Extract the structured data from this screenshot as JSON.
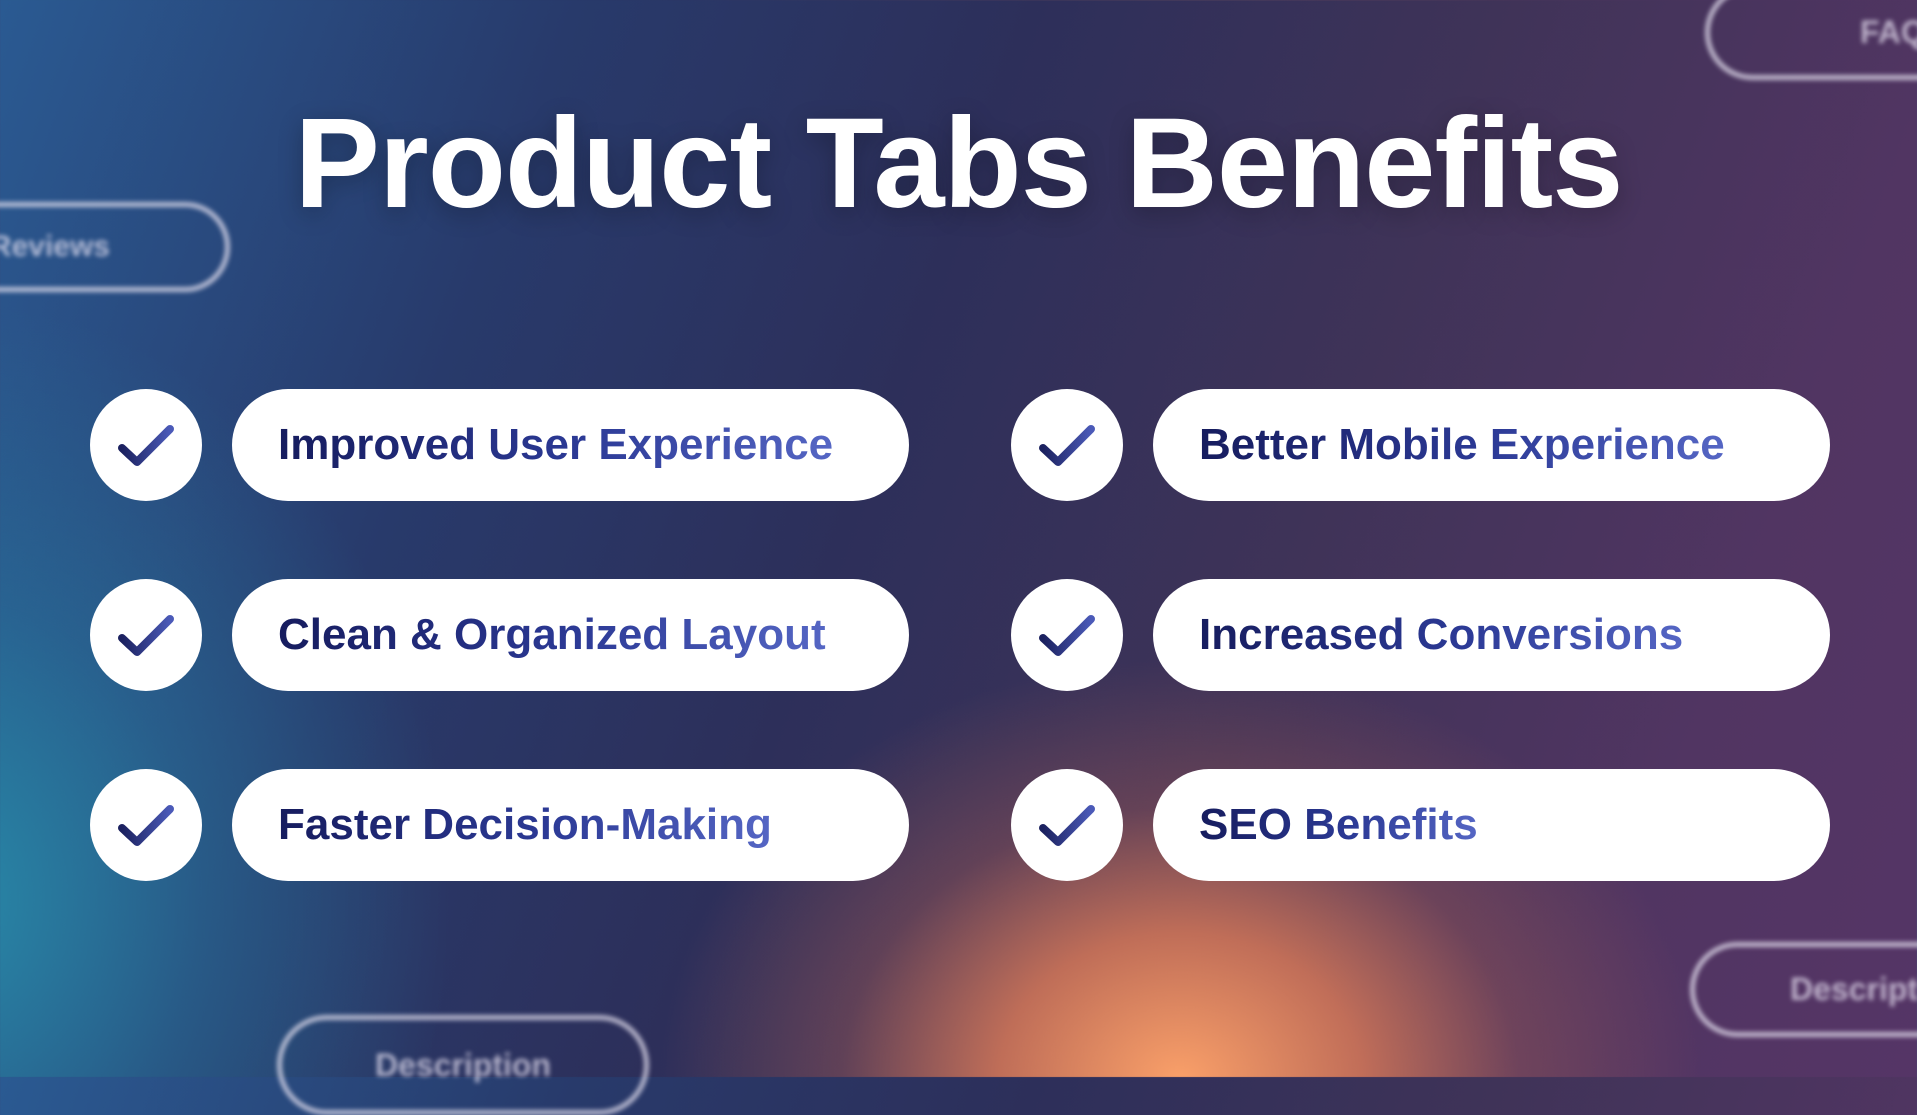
{
  "title": "Product Tabs Benefits",
  "background_tabs": [
    "Reviews",
    "FAQ",
    "Description",
    "Description"
  ],
  "benefits": [
    {
      "label": "Improved User Experience",
      "icon": "check-icon"
    },
    {
      "label": "Better Mobile Experience",
      "icon": "check-icon"
    },
    {
      "label": "Clean & Organized Layout",
      "icon": "check-icon"
    },
    {
      "label": "Increased Conversions",
      "icon": "check-icon"
    },
    {
      "label": "Faster Decision-Making",
      "icon": "check-icon"
    },
    {
      "label": "SEO Benefits",
      "icon": "check-icon"
    }
  ],
  "colors": {
    "text_dark": "#161c5e",
    "text_light": "#5566c4",
    "pill_bg": "#ffffff"
  }
}
